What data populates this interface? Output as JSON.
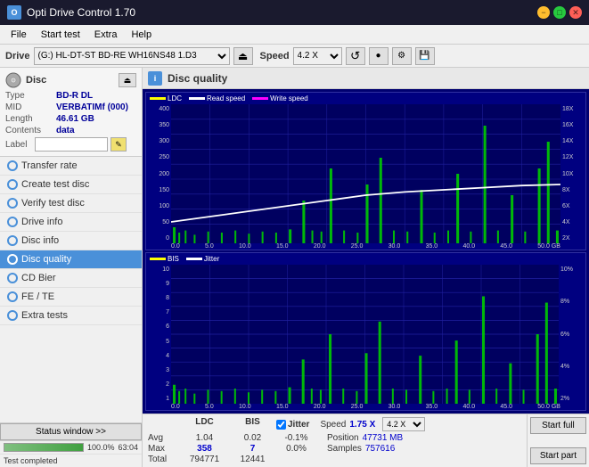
{
  "app": {
    "title": "Opti Drive Control 1.70",
    "icon": "O"
  },
  "titlebar": {
    "minimize": "−",
    "maximize": "□",
    "close": "✕"
  },
  "menubar": {
    "items": [
      "File",
      "Start test",
      "Extra",
      "Help"
    ]
  },
  "drive_bar": {
    "drive_label": "Drive",
    "drive_value": "(G:) HL-DT-ST BD-RE  WH16NS48 1.D3",
    "speed_label": "Speed",
    "speed_value": "4.2 X",
    "eject_icon": "⏏",
    "refresh_icon": "↺",
    "burn_icon": "●",
    "settings_icon": "⚙",
    "save_icon": "💾"
  },
  "disc": {
    "header": "Disc",
    "type_label": "Type",
    "type_value": "BD-R DL",
    "mid_label": "MID",
    "mid_value": "VERBATIMf (000)",
    "length_label": "Length",
    "length_value": "46.61 GB",
    "contents_label": "Contents",
    "contents_value": "data",
    "label_label": "Label",
    "label_value": "",
    "label_placeholder": ""
  },
  "nav": {
    "items": [
      {
        "id": "transfer-rate",
        "label": "Transfer rate",
        "active": false
      },
      {
        "id": "create-test-disc",
        "label": "Create test disc",
        "active": false
      },
      {
        "id": "verify-test-disc",
        "label": "Verify test disc",
        "active": false
      },
      {
        "id": "drive-info",
        "label": "Drive info",
        "active": false
      },
      {
        "id": "disc-info",
        "label": "Disc info",
        "active": false
      },
      {
        "id": "disc-quality",
        "label": "Disc quality",
        "active": true
      },
      {
        "id": "cd-bier",
        "label": "CD Bier",
        "active": false
      },
      {
        "id": "fe-te",
        "label": "FE / TE",
        "active": false
      },
      {
        "id": "extra-tests",
        "label": "Extra tests",
        "active": false
      }
    ]
  },
  "status": {
    "btn_label": "Status window >>",
    "progress_pct": 100,
    "progress_display": "100.0%",
    "counter": "63:04",
    "status_text": "Test completed"
  },
  "chart": {
    "title": "Disc quality",
    "legend_top": [
      {
        "id": "ldc",
        "label": "LDC",
        "color": "#ffff00"
      },
      {
        "id": "read-speed",
        "label": "Read speed",
        "color": "#ffffff"
      },
      {
        "id": "write-speed",
        "label": "Write speed",
        "color": "#ff00ff"
      }
    ],
    "legend_bottom": [
      {
        "id": "bis",
        "label": "BIS",
        "color": "#ffff00"
      },
      {
        "id": "jitter",
        "label": "Jitter",
        "color": "#ffffff"
      }
    ],
    "top_yaxis_left": [
      "400",
      "350",
      "300",
      "250",
      "200",
      "150",
      "100",
      "50",
      "0"
    ],
    "top_yaxis_right": [
      "18X",
      "16X",
      "14X",
      "12X",
      "10X",
      "8X",
      "6X",
      "4X",
      "2X"
    ],
    "bottom_yaxis_left": [
      "10",
      "9",
      "8",
      "7",
      "6",
      "5",
      "4",
      "3",
      "2",
      "1"
    ],
    "bottom_yaxis_right": [
      "10%",
      "8%",
      "6%",
      "4%",
      "2%"
    ],
    "xaxis": [
      "0.0",
      "5.0",
      "10.0",
      "15.0",
      "20.0",
      "25.0",
      "30.0",
      "35.0",
      "40.0",
      "45.0",
      "50.0 GB"
    ]
  },
  "stats": {
    "col_ldc": "LDC",
    "col_bis": "BIS",
    "jitter_label": "Jitter",
    "speed_label": "Speed",
    "speed_value": "1.75 X",
    "speed_select": "4.2 X",
    "position_label": "Position",
    "position_value": "47731 MB",
    "samples_label": "Samples",
    "samples_value": "757616",
    "rows": [
      {
        "label": "Avg",
        "ldc": "1.04",
        "bis": "0.02",
        "jitter": "-0.1%"
      },
      {
        "label": "Max",
        "ldc": "358",
        "bis": "7",
        "jitter": "0.0%"
      },
      {
        "label": "Total",
        "ldc": "794771",
        "bis": "12441",
        "jitter": ""
      }
    ],
    "start_full_label": "Start full",
    "start_part_label": "Start part"
  }
}
